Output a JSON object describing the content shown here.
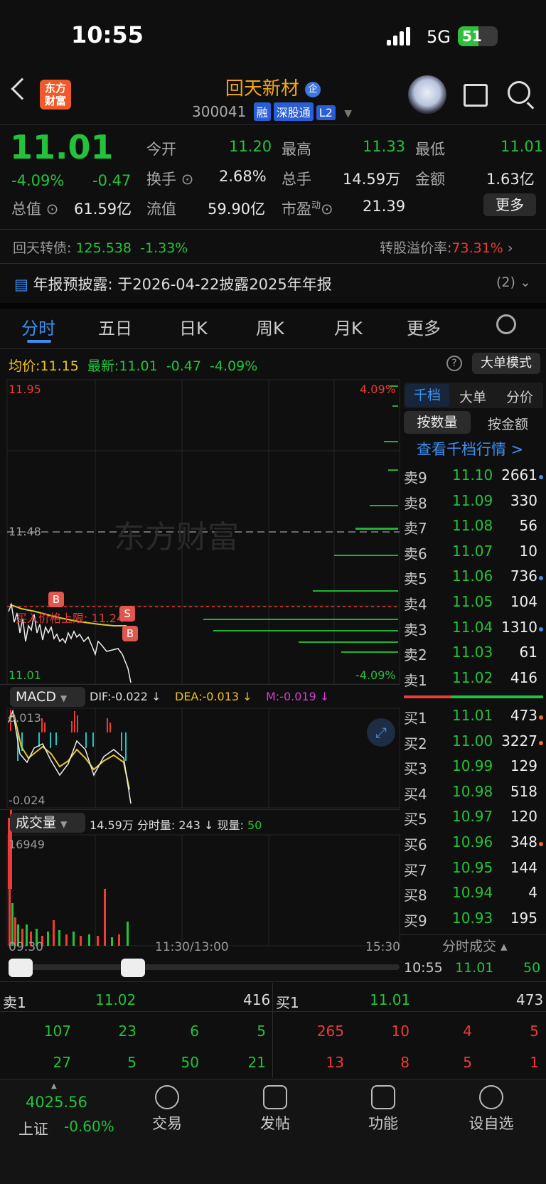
{
  "status": {
    "time": "10:55",
    "network": "5G",
    "battery": "51"
  },
  "header": {
    "name": "回天新材",
    "qi": "企",
    "code": "300041",
    "tags": [
      "融",
      "深股通",
      "L2"
    ],
    "logo": "东方财富"
  },
  "quote": {
    "price": "11.01",
    "pct": "-4.09%",
    "chg": "-0.47",
    "open_l": "今开",
    "open": "11.20",
    "high_l": "最高",
    "high": "11.33",
    "low_l": "最低",
    "low": "11.01",
    "turn_l": "换手",
    "turn": "2.68%",
    "vol_l": "总手",
    "vol": "14.59万",
    "amt_l": "金额",
    "amt": "1.63亿",
    "cap_l": "总值",
    "cap": "61.59亿",
    "float_l": "流值",
    "float": "59.90亿",
    "pe_l": "市盈",
    "pe_sup": "动",
    "pe": "21.39",
    "more": "更多"
  },
  "bond": {
    "label": "回天转债:",
    "price": "125.538",
    "pct": "-1.33%",
    "premium_l": "转股溢价率:",
    "premium": "73.31%"
  },
  "notice": {
    "text": "年报预披露: 于2026-04-22披露2025年年报",
    "count": "(2)"
  },
  "tabs": [
    "分时",
    "五日",
    "日K",
    "周K",
    "月K",
    "更多"
  ],
  "info": {
    "avg_l": "均价:",
    "avg": "11.15",
    "last_l": "最新:",
    "last": "11.01",
    "chg": "-0.47",
    "pct": "-4.09%",
    "mode": "大单模式"
  },
  "chart": {
    "top": "11.95",
    "top_pct": "4.09%",
    "mid": "11.48",
    "bottom": "11.01",
    "bottom_pct": "-4.09%",
    "limit": "买入价格上限: 11.24",
    "watermark": "东方财富",
    "b1": "B",
    "b2": "B",
    "s1": "S",
    "macd_l": "MACD",
    "dif": "DIF:-0.022 ↓",
    "dea": "DEA:-0.013 ↓",
    "m": "M:-0.019 ↓",
    "macd_top": "0.013",
    "macd_bot": "-0.024",
    "vol_l": "成交量",
    "vol_info": "14.59万 分时量: 243 ↓ 现量:",
    "vol_now": "50",
    "vol_top": "16949",
    "t1": "09:30",
    "t2": "11:30/13:00",
    "t3": "15:30"
  },
  "ob_tabs": [
    "千档",
    "大单",
    "分价"
  ],
  "ob_sub": [
    "按数量",
    "按金额"
  ],
  "ob_link": "查看千档行情 >",
  "asks": [
    {
      "l": "卖9",
      "p": "11.10",
      "v": "2661"
    },
    {
      "l": "卖8",
      "p": "11.09",
      "v": "330"
    },
    {
      "l": "卖7",
      "p": "11.08",
      "v": "56"
    },
    {
      "l": "卖6",
      "p": "11.07",
      "v": "10"
    },
    {
      "l": "卖5",
      "p": "11.06",
      "v": "736"
    },
    {
      "l": "卖4",
      "p": "11.05",
      "v": "104"
    },
    {
      "l": "卖3",
      "p": "11.04",
      "v": "1310"
    },
    {
      "l": "卖2",
      "p": "11.03",
      "v": "61"
    },
    {
      "l": "卖1",
      "p": "11.02",
      "v": "416"
    }
  ],
  "bids": [
    {
      "l": "买1",
      "p": "11.01",
      "v": "473"
    },
    {
      "l": "买2",
      "p": "11.00",
      "v": "3227"
    },
    {
      "l": "买3",
      "p": "10.99",
      "v": "129"
    },
    {
      "l": "买4",
      "p": "10.98",
      "v": "518"
    },
    {
      "l": "买5",
      "p": "10.97",
      "v": "120"
    },
    {
      "l": "买6",
      "p": "10.96",
      "v": "348"
    },
    {
      "l": "买7",
      "p": "10.95",
      "v": "144"
    },
    {
      "l": "买8",
      "p": "10.94",
      "v": "4"
    },
    {
      "l": "买9",
      "p": "10.93",
      "v": "195"
    }
  ],
  "trades": {
    "title": "分时成交",
    "time": "10:55",
    "price": "11.01",
    "vol": "50"
  },
  "queue": {
    "sell_l": "卖1",
    "sell_p": "11.02",
    "sell_v": "416",
    "buy_l": "买1",
    "buy_p": "11.01",
    "buy_v": "473",
    "sell_rows": [
      [
        "107",
        "23",
        "6",
        "5"
      ],
      [
        "27",
        "5",
        "50",
        "21"
      ]
    ],
    "buy_rows": [
      [
        "265",
        "10",
        "4",
        "5"
      ],
      [
        "13",
        "8",
        "5",
        "1"
      ]
    ]
  },
  "bottom": {
    "index": "4025.56",
    "index_l": "上证",
    "index_pct": "-0.60%",
    "nav": [
      "交易",
      "发帖",
      "功能",
      "设自选"
    ]
  }
}
